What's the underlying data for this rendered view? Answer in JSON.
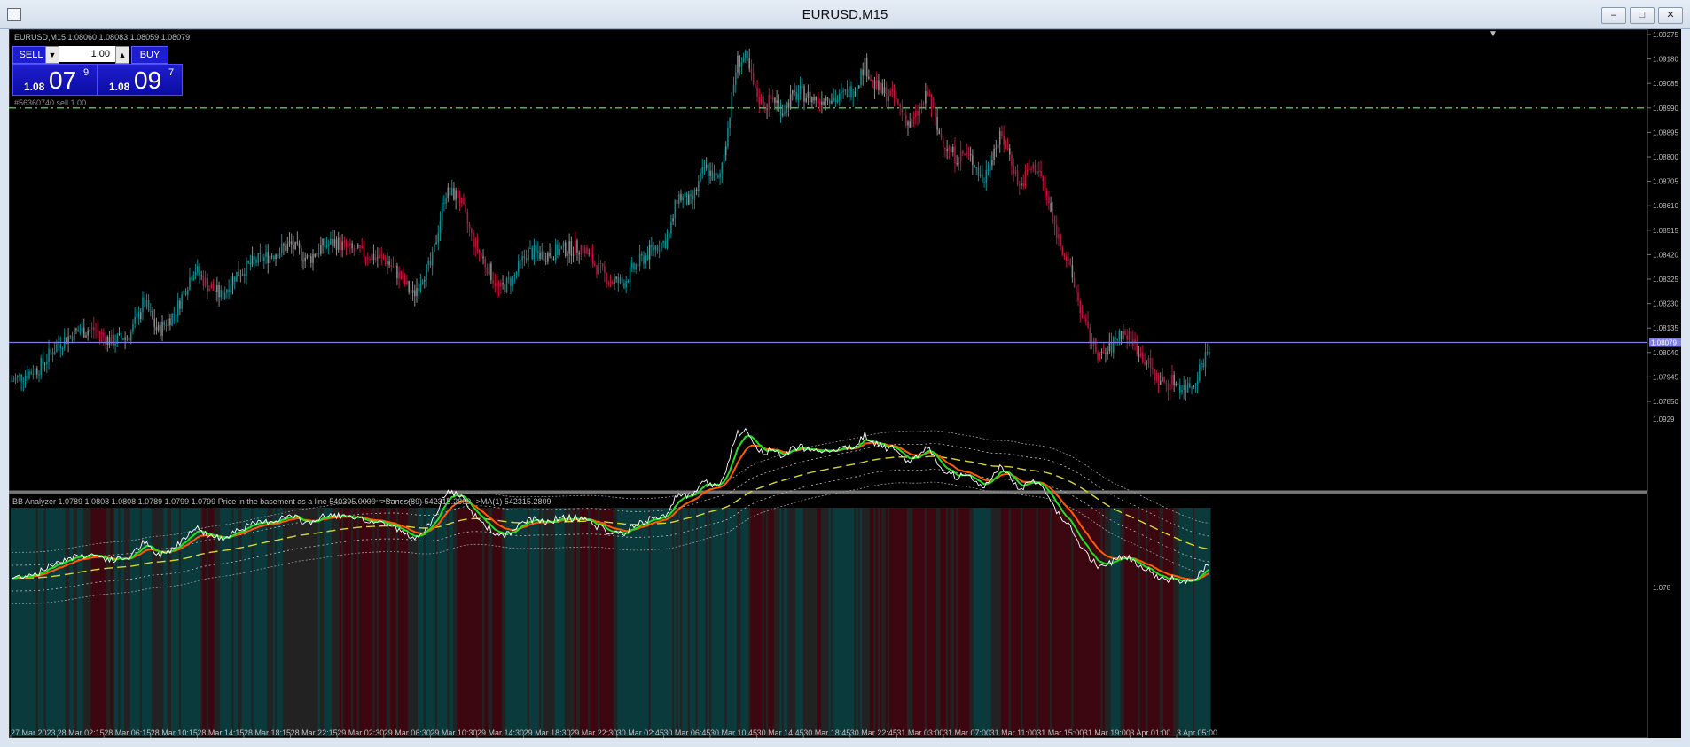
{
  "window": {
    "title": "EURUSD,M15"
  },
  "chart_header": "EURUSD,M15  1.08060 1.08083 1.08059 1.08079",
  "trade_panel": {
    "sell_label": "SELL",
    "buy_label": "BUY",
    "lot": "1.00",
    "sell_base": "1.08",
    "sell_big": "07",
    "sell_sup": "9",
    "buy_base": "1.08",
    "buy_big": "09",
    "buy_sup": "7"
  },
  "order_line_label": "#56360740 sell 1.00",
  "indicator_header": "BB Analyzer 1.0789 1.0808 1.0808 1.0789 1.0799 1.0799  Price in the basement as a line 540395.0000  ->Bands(89) 542315.2809  ->MA(1) 542315.2809",
  "colors": {
    "bull": "#138a8f",
    "bear": "#b5173f",
    "neutral": "#8c8c8c",
    "bid_line": "#7f7fe6",
    "order_line": "#39c23a",
    "fast_line": "#21e021",
    "slow_line": "#ff5a00",
    "mid_band": "#d6d62a"
  },
  "chart_data": [
    {
      "type": "candlestick",
      "title": "EURUSD,M15",
      "ylim": [
        1.0785,
        1.0929
      ],
      "y_ticks": [
        "1.09275",
        "1.09180",
        "1.09085",
        "1.08990",
        "1.08895",
        "1.08800",
        "1.08705",
        "1.08610",
        "1.08515",
        "1.08420",
        "1.08325",
        "1.08230",
        "1.08135",
        "1.08040",
        "1.07945",
        "1.07850"
      ],
      "x_ticks": [
        "27 Mar 2023",
        "28 Mar 02:15",
        "28 Mar 06:15",
        "28 Mar 10:15",
        "28 Mar 14:15",
        "28 Mar 18:15",
        "28 Mar 22:15",
        "29 Mar 02:30",
        "29 Mar 06:30",
        "29 Mar 10:30",
        "29 Mar 14:30",
        "29 Mar 18:30",
        "29 Mar 22:30",
        "30 Mar 02:45",
        "30 Mar 06:45",
        "30 Mar 10:45",
        "30 Mar 14:45",
        "30 Mar 18:45",
        "30 Mar 22:45",
        "31 Mar 03:00",
        "31 Mar 07:00",
        "31 Mar 11:00",
        "31 Mar 15:00",
        "31 Mar 19:00",
        "3 Apr 01:00",
        "3 Apr 05:00"
      ],
      "current_price": 1.08079,
      "current_price_label": "1.08079",
      "order_line_price": 1.0899,
      "close_path": [
        [
          0,
          1.0793
        ],
        [
          6,
          1.0798
        ],
        [
          10,
          1.0807
        ],
        [
          14,
          1.0812
        ],
        [
          18,
          1.0813
        ],
        [
          22,
          1.0808
        ],
        [
          26,
          1.0811
        ],
        [
          29,
          1.0824
        ],
        [
          32,
          1.0812
        ],
        [
          36,
          1.082
        ],
        [
          40,
          1.0837
        ],
        [
          43,
          1.083
        ],
        [
          46,
          1.0826
        ],
        [
          49,
          1.0834
        ],
        [
          53,
          1.0839
        ],
        [
          57,
          1.0842
        ],
        [
          61,
          1.0846
        ],
        [
          65,
          1.084
        ],
        [
          68,
          1.0845
        ],
        [
          71,
          1.0847
        ],
        [
          74,
          1.0844
        ],
        [
          78,
          1.0842
        ],
        [
          82,
          1.084
        ],
        [
          85,
          1.0834
        ],
        [
          88,
          1.0826
        ],
        [
          90,
          1.0834
        ],
        [
          92,
          1.0838
        ],
        [
          95,
          1.0866
        ],
        [
          98,
          1.0865
        ],
        [
          101,
          1.0848
        ],
        [
          104,
          1.0838
        ],
        [
          107,
          1.0828
        ],
        [
          110,
          1.0833
        ],
        [
          113,
          1.0843
        ],
        [
          117,
          1.0842
        ],
        [
          121,
          1.0844
        ],
        [
          125,
          1.0845
        ],
        [
          128,
          1.0838
        ],
        [
          131,
          1.0832
        ],
        [
          134,
          1.0831
        ],
        [
          137,
          1.0838
        ],
        [
          141,
          1.0845
        ],
        [
          144,
          1.0848
        ],
        [
          146,
          1.0865
        ],
        [
          149,
          1.0862
        ],
        [
          152,
          1.0876
        ],
        [
          155,
          1.087
        ],
        [
          157,
          1.0891
        ],
        [
          159,
          1.0917
        ],
        [
          161,
          1.0918
        ],
        [
          163,
          1.0905
        ],
        [
          165,
          1.09
        ],
        [
          167,
          1.0903
        ],
        [
          169,
          1.0898
        ],
        [
          171,
          1.0903
        ],
        [
          173,
          1.0905
        ],
        [
          175,
          1.0903
        ],
        [
          177,
          1.0902
        ],
        [
          179,
          1.0904
        ],
        [
          181,
          1.0902
        ],
        [
          183,
          1.0905
        ],
        [
          185,
          1.0907
        ],
        [
          187,
          1.0916
        ],
        [
          189,
          1.0908
        ],
        [
          191,
          1.0905
        ],
        [
          193,
          1.0904
        ],
        [
          195,
          1.0898
        ],
        [
          197,
          1.0892
        ],
        [
          199,
          1.0898
        ],
        [
          201,
          1.0905
        ],
        [
          203,
          1.089
        ],
        [
          205,
          1.0884
        ],
        [
          207,
          1.088
        ],
        [
          209,
          1.0881
        ],
        [
          211,
          1.0878
        ],
        [
          213,
          1.087
        ],
        [
          215,
          1.0882
        ],
        [
          217,
          1.0888
        ],
        [
          219,
          1.088
        ],
        [
          221,
          1.0868
        ],
        [
          223,
          1.0875
        ],
        [
          225,
          1.0876
        ],
        [
          227,
          1.0864
        ],
        [
          229,
          1.0851
        ],
        [
          231,
          1.0842
        ],
        [
          233,
          1.083
        ],
        [
          235,
          1.0816
        ],
        [
          237,
          1.0807
        ],
        [
          239,
          1.0802
        ],
        [
          241,
          1.0806
        ],
        [
          243,
          1.0812
        ],
        [
          245,
          1.081
        ],
        [
          247,
          1.0805
        ],
        [
          249,
          1.08
        ],
        [
          251,
          1.0794
        ],
        [
          253,
          1.0792
        ],
        [
          255,
          1.0793
        ],
        [
          257,
          1.079
        ],
        [
          259,
          1.0792
        ],
        [
          261,
          1.08
        ],
        [
          263,
          1.0808
        ]
      ]
    },
    {
      "type": "line",
      "title": "BB Analyzer",
      "series": [
        {
          "name": "Price in the basement as a line",
          "line": "price"
        },
        {
          "name": "Bands(89)",
          "line": "band"
        },
        {
          "name": "MA(1)",
          "line": "ma"
        }
      ],
      "ylim": [
        1.078,
        1.0929
      ],
      "y_ticks": [
        "1.0929",
        "1.078"
      ]
    }
  ]
}
